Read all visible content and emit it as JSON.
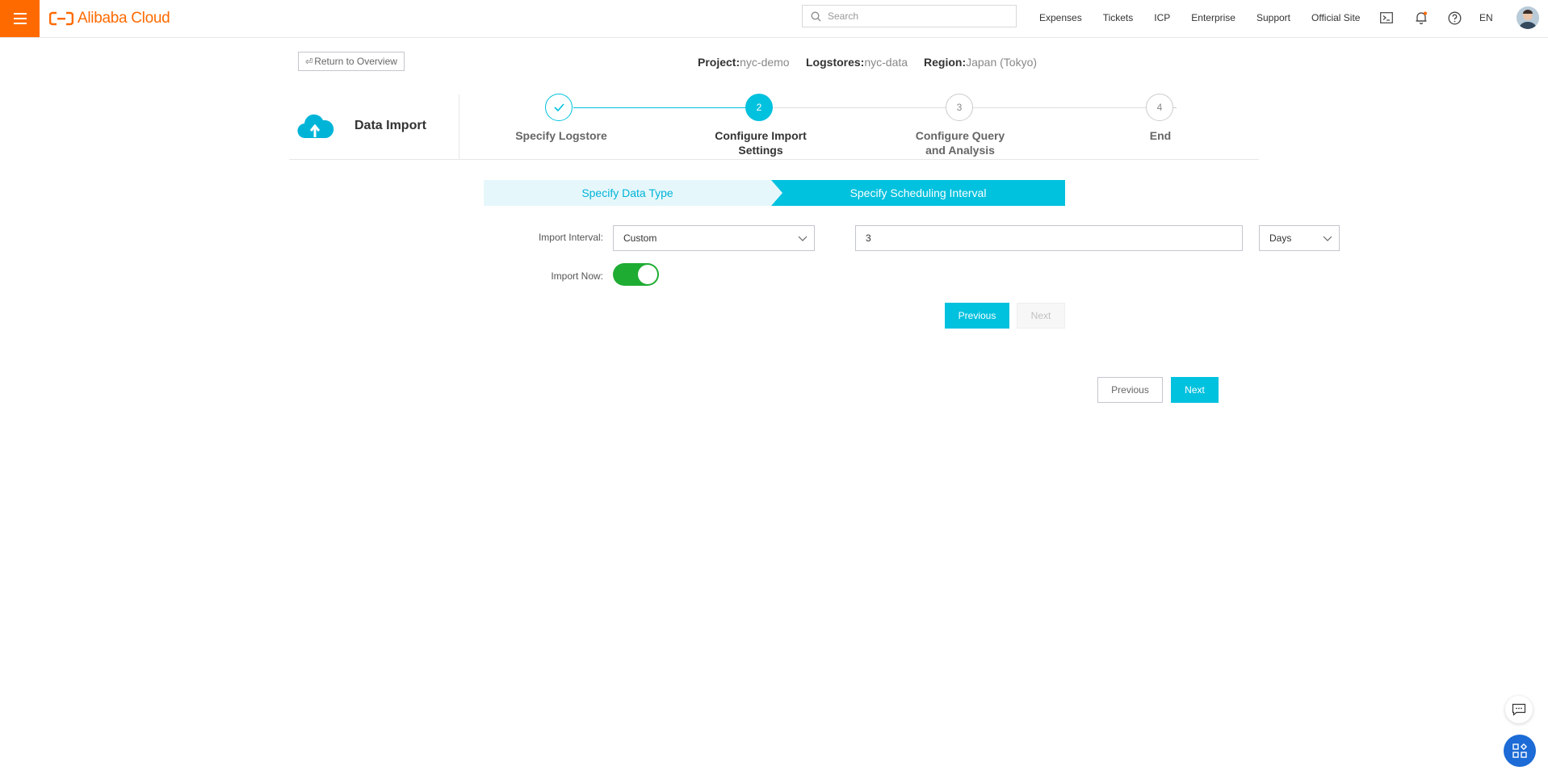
{
  "topbar": {
    "brand": "Alibaba Cloud",
    "search_placeholder": "Search",
    "links": [
      "Expenses",
      "Tickets",
      "ICP",
      "Enterprise",
      "Support",
      "Official Site"
    ],
    "language": "EN",
    "icons": [
      "terminal-icon",
      "bell-icon",
      "help-icon"
    ]
  },
  "header": {
    "return_label": "Return to Overview",
    "project_label": "Project:",
    "project_value": "nyc-demo",
    "logstores_label": "Logstores:",
    "logstores_value": "nyc-data",
    "region_label": "Region:",
    "region_value": "Japan (Tokyo)"
  },
  "wizard": {
    "title": "Data Import",
    "steps": [
      {
        "number": "",
        "label_line1": "Specify Logstore",
        "label_line2": "",
        "state": "done"
      },
      {
        "number": "2",
        "label_line1": "Configure Import",
        "label_line2": "Settings",
        "state": "current"
      },
      {
        "number": "3",
        "label_line1": "Configure Query",
        "label_line2": "and Analysis",
        "state": "pending"
      },
      {
        "number": "4",
        "label_line1": "End",
        "label_line2": "",
        "state": "pending"
      }
    ]
  },
  "substeps": {
    "first": "Specify Data Type",
    "second": "Specify Scheduling Interval"
  },
  "form": {
    "import_interval_label": "Import Interval:",
    "interval_mode": "Custom",
    "interval_value": "3",
    "interval_unit": "Days",
    "import_now_label": "Import Now:",
    "import_now_on": true
  },
  "inner_buttons": {
    "previous": "Previous",
    "next": "Next"
  },
  "footer_buttons": {
    "previous": "Previous",
    "next": "Next"
  },
  "colors": {
    "brand": "#ff6a00",
    "accent": "#00c1de",
    "toggle_on": "#1fac33"
  }
}
